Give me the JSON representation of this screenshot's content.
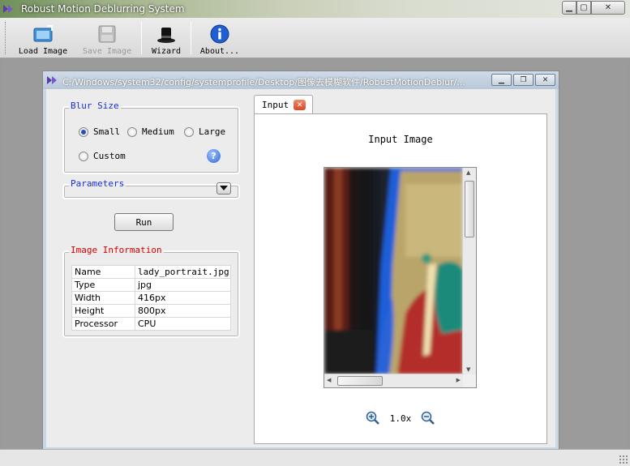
{
  "app": {
    "title": "Robust Motion Deblurring System"
  },
  "window_controls": {
    "minimize": "▁",
    "maximize": "▢",
    "close": "✕"
  },
  "toolbar": {
    "buttons": [
      {
        "label": "Load Image",
        "icon": "load-image-icon",
        "enabled": true
      },
      {
        "label": "Save Image",
        "icon": "save-icon",
        "enabled": false
      },
      {
        "label": "Wizard",
        "icon": "wizard-hat-icon",
        "enabled": true
      },
      {
        "label": "About...",
        "icon": "info-icon",
        "enabled": true
      }
    ]
  },
  "child_window": {
    "path": "C:/Windows/system32/config/systemprofile/Desktop/图像去模糊软件/RobustMotionDeblur/...",
    "controls": {
      "minimize": "▁",
      "restore": "❐",
      "close": "✕"
    }
  },
  "blur_size": {
    "title": "Blur Size",
    "options": [
      {
        "label": "Small",
        "selected": true
      },
      {
        "label": "Medium",
        "selected": false
      },
      {
        "label": "Large",
        "selected": false
      },
      {
        "label": "Custom",
        "selected": false
      }
    ],
    "help": "?"
  },
  "parameters": {
    "title": "Parameters"
  },
  "run_button": {
    "label": "Run"
  },
  "image_information": {
    "title": "Image Information",
    "rows": [
      {
        "key": "Name",
        "value": "lady_portrait.jpg ("
      },
      {
        "key": "Type",
        "value": "jpg"
      },
      {
        "key": "Width",
        "value": "416px"
      },
      {
        "key": "Height",
        "value": "800px"
      },
      {
        "key": "Processor",
        "value": "CPU"
      }
    ]
  },
  "tabs": [
    {
      "label": "Input",
      "close": "✕"
    }
  ],
  "input_panel": {
    "title": "Input Image",
    "zoom": "1.0x"
  },
  "colors": {
    "accent_blue": "#1a2fd0",
    "info_red": "#d40000",
    "tab_close": "#d24a2a"
  }
}
